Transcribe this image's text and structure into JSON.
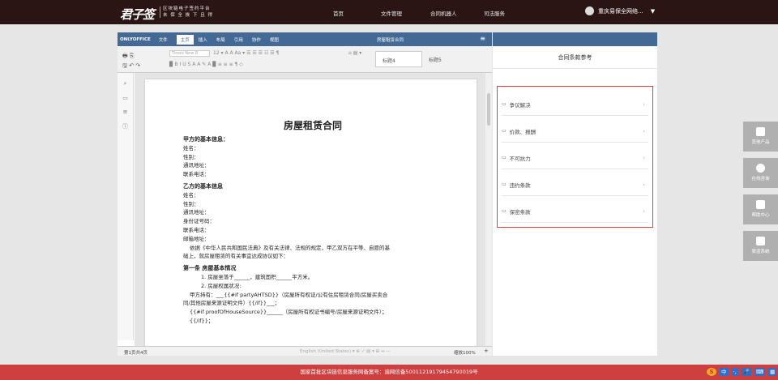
{
  "header": {
    "logo": "君子签",
    "logo_sub_line1": "区块链电子签约平台",
    "logo_sub_line2": "未 保 全 挨 下 且 得",
    "nav": [
      "首页",
      "文件管理",
      "合同机器人",
      "司法服务"
    ],
    "user_name": "重庆易保全网络..."
  },
  "editor": {
    "brand": "ONLYOFFICE",
    "tabs": [
      "文件",
      "主页",
      "插入",
      "布局",
      "引用",
      "协作",
      "视图"
    ],
    "active_tab": "主页",
    "doc_title": "房屋租赁合同",
    "font_name": "Times New R",
    "font_size": "12",
    "style_1": "标题4",
    "style_2": "标题5",
    "status_page": "第1页共4页",
    "status_lang": "English (United States)",
    "status_zoom": "缩放100%",
    "plus": "+"
  },
  "document": {
    "title": "房屋租赁合同",
    "party_a_heading": "甲方的基本信息：",
    "party_a_fields": [
      "姓名：",
      "性别：",
      "通讯地址：",
      "联系电话："
    ],
    "party_b_heading": "乙方的基本信息",
    "party_b_fields": [
      "姓名：",
      "性别：",
      "通讯地址：",
      "身份证号码：",
      "联系电话：",
      "邮箱地址："
    ],
    "preamble_1": "依据《中华人民共和国民法典》及有关法律、法规的规定，甲乙双方在平等、自愿的基",
    "preamble_2": "础上，就房屋租赁的有关事宜达成协议如下：",
    "article1_heading": "第一条  房屋基本情况",
    "item1": "1.  房屋坐落于______，建筑面积______平方米。",
    "item2": "2.  房屋权属状况:",
    "para3a": "甲方持有：___{{#if    partyAHTSD}}（房屋所有权证/公有住房租赁合同/房屋买卖合",
    "para3b": "同/其他房屋来源证明文件）{{/if}}___；",
    "para4a": "{{#if    proofOfHouseSource}}______（房屋所有权证书编号/房屋来源证明文件）；",
    "para4b": "{{/if}}；"
  },
  "panel": {
    "title": "合同条款参考",
    "clauses": [
      "争议解决",
      "价款、报酬",
      "不可抗力",
      "违约条款",
      "保密条款"
    ]
  },
  "side_buttons": [
    "其他产品",
    "在线咨询",
    "帮助中心",
    "渠道系统"
  ],
  "footer": {
    "text": "国家首批区块链信息服务网备案号：渝网信备50011219179454790019号",
    "ime": [
      "中",
      "·,",
      "🎤",
      "⌨",
      "▦"
    ]
  },
  "colors": {
    "topbar": "#2b1414",
    "editor_tabbar": "#446995",
    "highlight_border": "#e23b3b",
    "footer": "#ce3f3f"
  }
}
